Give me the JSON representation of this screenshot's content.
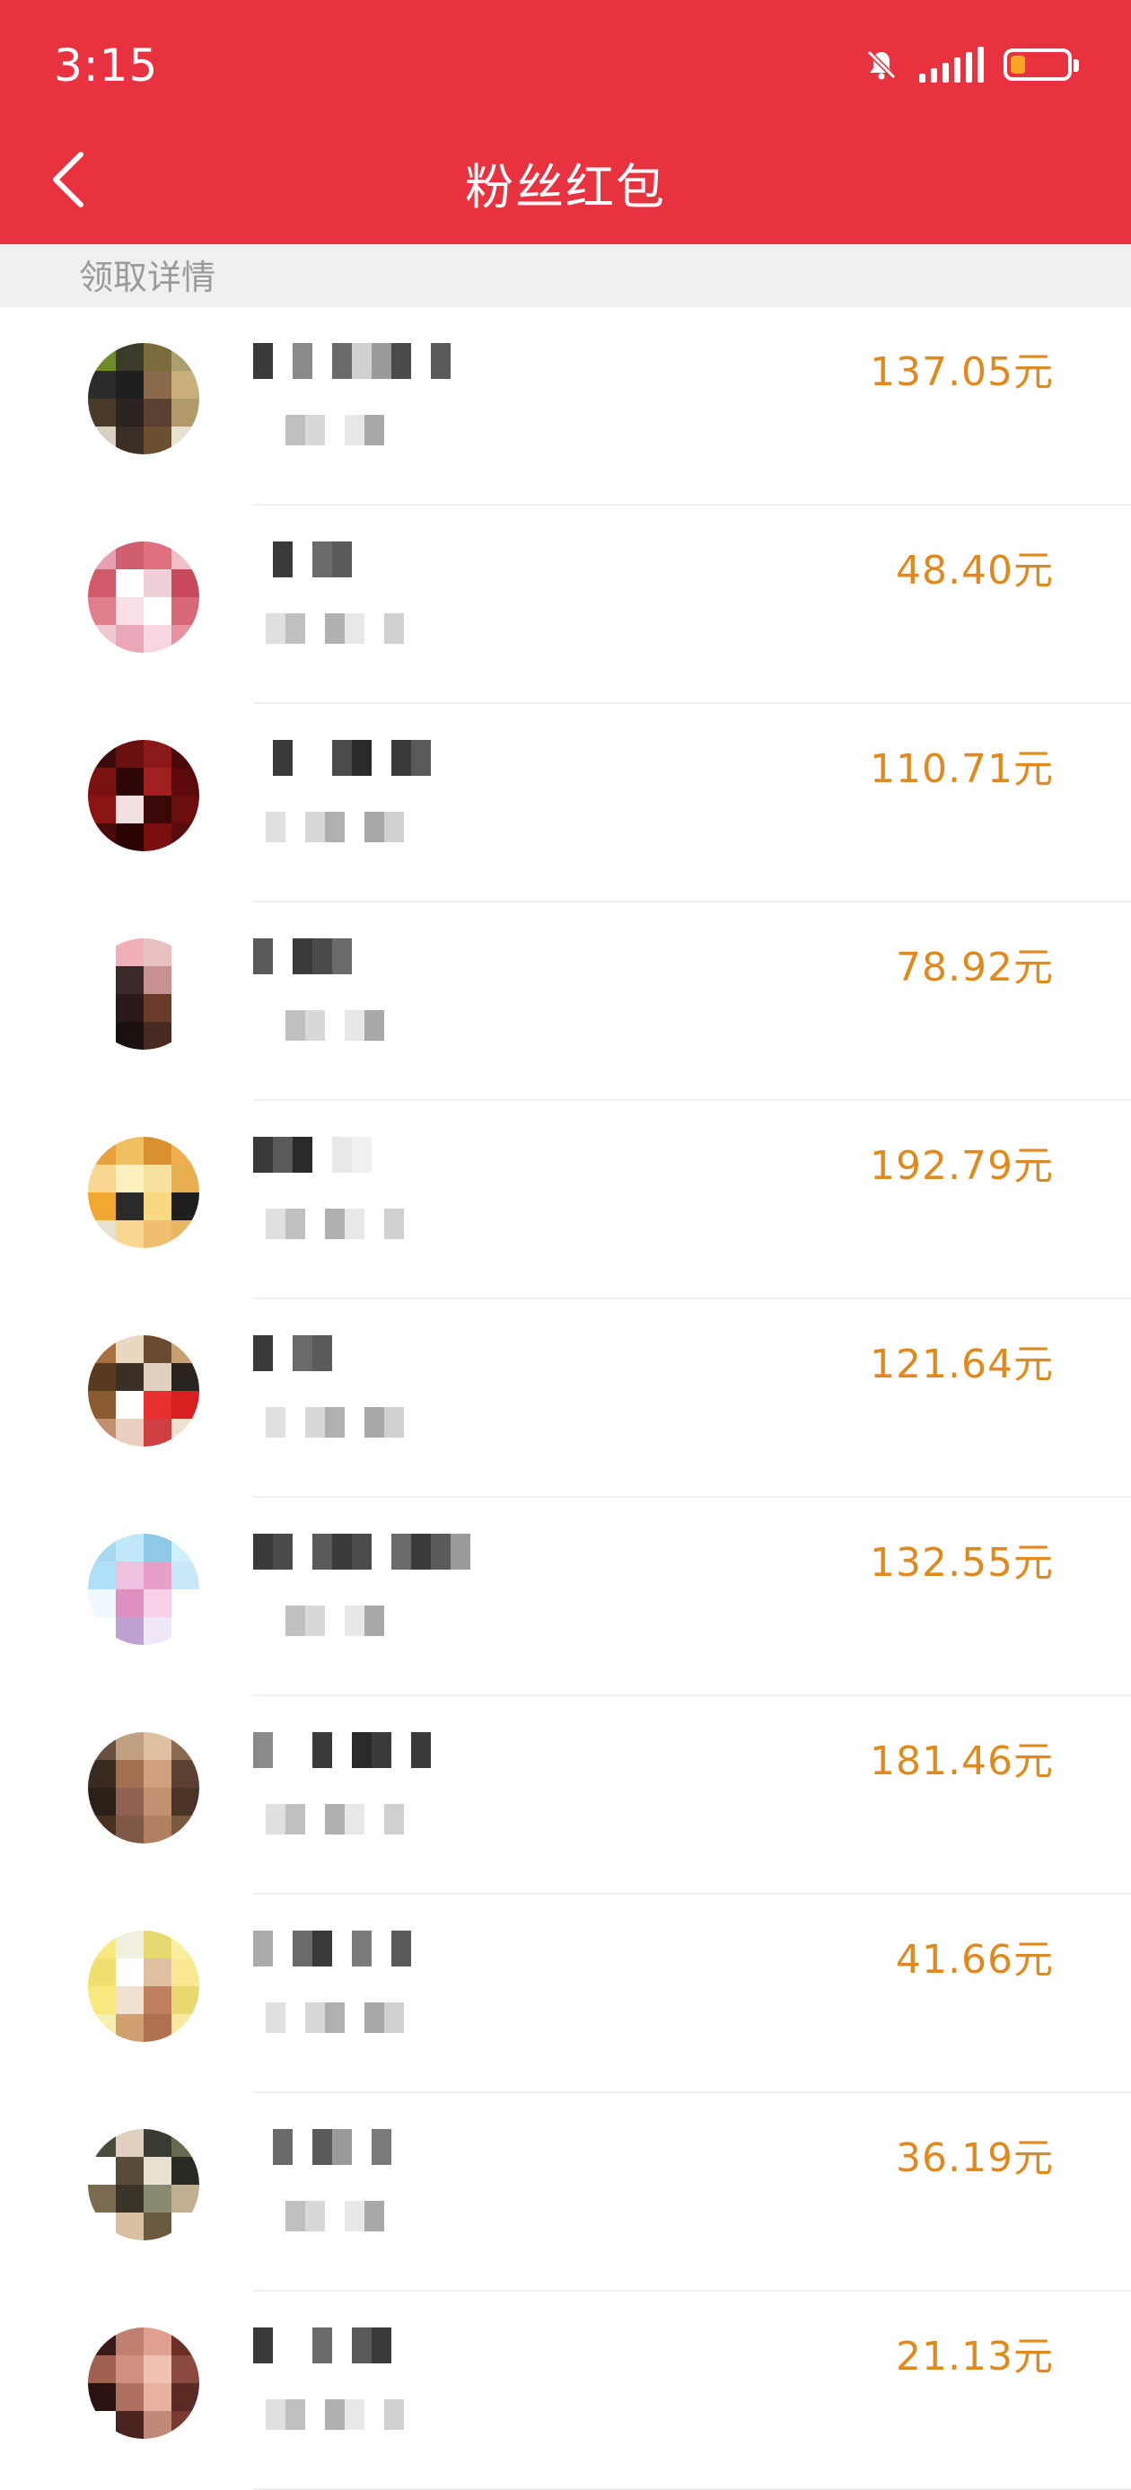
{
  "status_bar": {
    "time": "3:15",
    "icons": [
      "mute-bell-icon",
      "signal-icon",
      "battery-icon"
    ],
    "battery_color": "#f5a623"
  },
  "header": {
    "title": "粉丝红包",
    "back_icon": "back-chevron-icon",
    "background": "#e8323f"
  },
  "section": {
    "label": "领取详情"
  },
  "accent_amount_color": "#e08a1e",
  "recipients": [
    {
      "amount": "137.05元",
      "avatar_colors": [
        "#6f8a2f",
        "#3b3b2a",
        "#7c6b3c",
        "#a8a070",
        "#2c2c2a",
        "#1f1f1f",
        "#8a6a4a",
        "#c9b07a",
        "#4a3a2a",
        "#2a2320",
        "#5a4030",
        "#b09a6a",
        "#d8d0c0",
        "#3a2e26",
        "#6a5030",
        "#e8e0d0"
      ]
    },
    {
      "amount": "48.40元",
      "avatar_colors": [
        "#e8a0b0",
        "#d06070",
        "#e07080",
        "#f0c0c8",
        "#d05a6a",
        "#ffffff",
        "#f0d0d8",
        "#c84a5c",
        "#e0808e",
        "#f8e0e6",
        "#ffffff",
        "#d86878",
        "#f0c8d0",
        "#e8a8b8",
        "#f8d8e0",
        "#e890a0"
      ]
    },
    {
      "amount": "110.71元",
      "avatar_colors": [
        "#3a0a0a",
        "#6a1010",
        "#8a1a1a",
        "#4a0808",
        "#7a1212",
        "#2a0606",
        "#a02020",
        "#5a0a0a",
        "#8a1414",
        "#f0e0e0",
        "#3a0808",
        "#6a0e0e",
        "#4a0a0a",
        "#2a0404",
        "#7a1010",
        "#5a0c0c"
      ]
    },
    {
      "amount": "78.92元",
      "avatar_colors": [
        "#ffffff",
        "#f0b0b8",
        "#e8c0c0",
        "#ffffff",
        "#ffffff",
        "#3a2a2a",
        "#c89090",
        "#ffffff",
        "#ffffff",
        "#2a1a1a",
        "#6a3a2a",
        "#ffffff",
        "#ffffff",
        "#1a1010",
        "#4a2a20",
        "#ffffff"
      ]
    },
    {
      "amount": "192.79元",
      "avatar_colors": [
        "#e8a040",
        "#f0c060",
        "#d89030",
        "#f0b050",
        "#f8d890",
        "#fff0c0",
        "#f8e0a0",
        "#e8b050",
        "#f0a830",
        "#2a2a2a",
        "#f8d880",
        "#1e1e1e",
        "#e8e0d0",
        "#f8d890",
        "#f0c070",
        "#e8b860"
      ]
    },
    {
      "amount": "121.64元",
      "avatar_colors": [
        "#a87040",
        "#e8d8c0",
        "#6a4a30",
        "#c8a070",
        "#5a3a20",
        "#3a3028",
        "#e0d0c0",
        "#2a2420",
        "#8a5a30",
        "#ffffff",
        "#e83030",
        "#d82020",
        "#c09070",
        "#e8d0c0",
        "#d04040",
        "#f0e0d0"
      ]
    },
    {
      "amount": "132.55元",
      "avatar_colors": [
        "#a8d8f0",
        "#c0e8f8",
        "#90c8e8",
        "#d0f0ff",
        "#b0e0f8",
        "#f0c0e0",
        "#e8a0c8",
        "#c8e8f8",
        "#f0f8ff",
        "#e090c0",
        "#f8d0e8",
        "#ffffff",
        "#ffffff",
        "#c0a0d0",
        "#f0e8f8",
        "#ffffff"
      ]
    },
    {
      "amount": "181.46元",
      "avatar_colors": [
        "#6a5040",
        "#c0a080",
        "#e0c0a0",
        "#8a6a50",
        "#3a2a20",
        "#a07050",
        "#d0a080",
        "#5a4030",
        "#2a2018",
        "#906050",
        "#c09070",
        "#4a3428",
        "#4a3020",
        "#805848",
        "#b08060",
        "#7a5a40"
      ]
    },
    {
      "amount": "41.66元",
      "avatar_colors": [
        "#f8e880",
        "#f0f0e0",
        "#e8d870",
        "#f8f0a0",
        "#f0e070",
        "#ffffff",
        "#e0c0a0",
        "#f8e890",
        "#f8e880",
        "#f0e0d0",
        "#c08060",
        "#e8d870",
        "#f8f0b0",
        "#d0a070",
        "#b07050",
        "#f8e8a0"
      ]
    },
    {
      "amount": "36.19元",
      "avatar_colors": [
        "#4a4a3a",
        "#e0d0c0",
        "#3a3a30",
        "#6a6a50",
        "#ffffff",
        "#5a4a3a",
        "#e8e0d0",
        "#2a2a24",
        "#7a6a50",
        "#3a3428",
        "#8a8a70",
        "#c0b090",
        "#ffffff",
        "#d8c0a0",
        "#6a5a40",
        "#ffffff"
      ]
    },
    {
      "amount": "21.13元",
      "avatar_colors": [
        "#3a1a18",
        "#c08070",
        "#e0a090",
        "#6a3028",
        "#a06050",
        "#d09080",
        "#f0c0b0",
        "#8a4a40",
        "#2a1210",
        "#b07060",
        "#e8b0a0",
        "#5a2a24",
        "#ffffff",
        "#4a2420",
        "#c08878",
        "#7a3a30"
      ]
    }
  ],
  "name_blur_colors": [
    [
      "#3a3a3a",
      "#ffffff",
      "#8a8a8a",
      "#ffffff",
      "#6a6a6a",
      "#d0d0d0",
      "#9a9a9a",
      "#4a4a4a",
      "#ffffff",
      "#5a5a5a"
    ],
    [
      "#ffffff",
      "#3a3a3a",
      "#ffffff",
      "#6a6a6a",
      "#5a5a5a"
    ],
    [
      "#ffffff",
      "#3a3a3a",
      "#ffffff",
      "#ffffff",
      "#4a4a4a",
      "#2a2a2a",
      "#ffffff",
      "#3a3a3a",
      "#5a5a5a"
    ],
    [
      "#5a5a5a",
      "#ffffff",
      "#3a3a3a",
      "#4a4a4a",
      "#6a6a6a"
    ],
    [
      "#3a3a3a",
      "#5a5a5a",
      "#2a2a2a",
      "#ffffff",
      "#e8e8e8",
      "#f0f0f0"
    ],
    [
      "#3a3a3a",
      "#ffffff",
      "#6a6a6a",
      "#5a5a5a"
    ],
    [
      "#3a3a3a",
      "#4a4a4a",
      "#ffffff",
      "#5a5a5a",
      "#3a3a3a",
      "#4a4a4a",
      "#ffffff",
      "#6a6a6a",
      "#3a3a3a",
      "#5a5a5a",
      "#9a9a9a"
    ],
    [
      "#8a8a8a",
      "#ffffff",
      "#ffffff",
      "#3a3a3a",
      "#ffffff",
      "#2a2a2a",
      "#3a3a3a",
      "#ffffff",
      "#3a3a3a"
    ],
    [
      "#aaaaaa",
      "#ffffff",
      "#6a6a6a",
      "#3a3a3a",
      "#ffffff",
      "#7a7a7a",
      "#ffffff",
      "#5a5a5a"
    ],
    [
      "#ffffff",
      "#6a6a6a",
      "#ffffff",
      "#5a5a5a",
      "#9a9a9a",
      "#ffffff",
      "#7a7a7a"
    ],
    [
      "#3a3a3a",
      "#ffffff",
      "#ffffff",
      "#6a6a6a",
      "#ffffff",
      "#5a5a5a",
      "#3a3a3a"
    ]
  ],
  "sub_blur_colors": [
    "#e0e0e0",
    "#c0c0c0",
    "#d8d8d8",
    "#b0b0b0",
    "#e8e8e8",
    "#a8a8a8",
    "#d0d0d0"
  ]
}
